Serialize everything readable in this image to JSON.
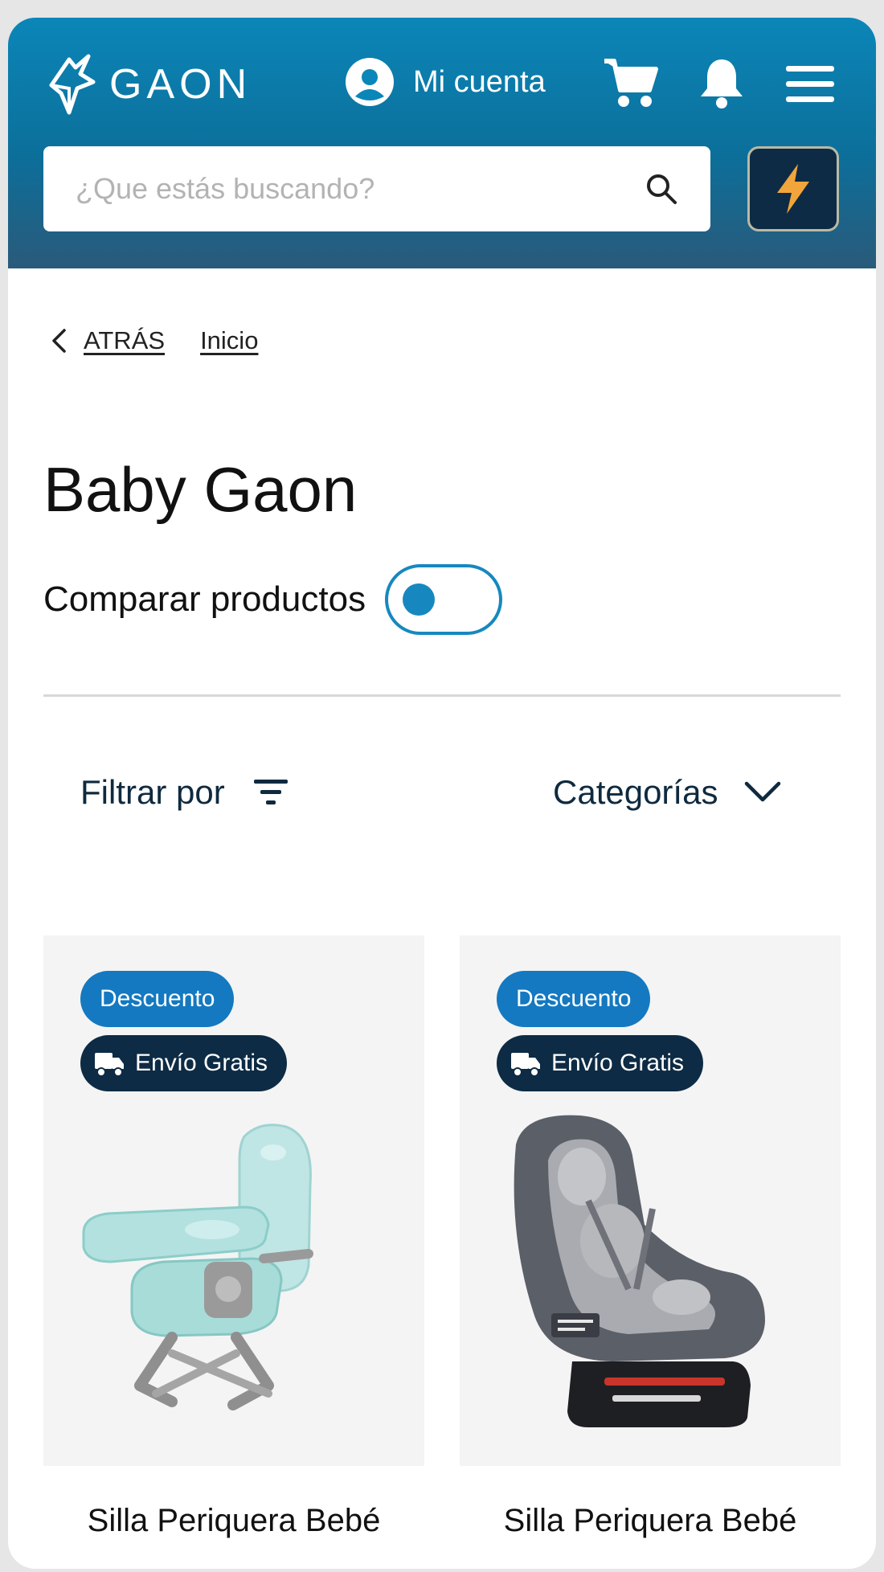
{
  "header": {
    "logo_text": "GAON",
    "account_label": "Mi cuenta",
    "search_placeholder": "¿Que estás buscando?",
    "accent_color": "#0b86b8",
    "flash_color": "#f2a53a"
  },
  "breadcrumb": {
    "back_label": "ATRÁS",
    "home_label": "Inicio"
  },
  "page": {
    "title": "Baby Gaon",
    "compare_label": "Comparar productos",
    "compare_enabled": false
  },
  "toolbar": {
    "filter_label": "Filtrar por",
    "category_label": "Categorías"
  },
  "products": [
    {
      "discount_label": "Descuento",
      "shipping_label": "Envío Gratis",
      "name": "Silla Periquera Bebé",
      "image_icon": "high-chair"
    },
    {
      "discount_label": "Descuento",
      "shipping_label": "Envío Gratis",
      "name": "Silla Periquera Bebé",
      "image_icon": "car-seat"
    }
  ]
}
